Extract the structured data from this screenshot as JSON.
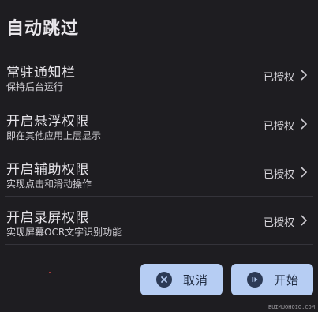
{
  "dialog": {
    "title": "自动跳过"
  },
  "items": [
    {
      "title": "常驻通知栏",
      "subtitle": "保持后台运行",
      "status": "已授权"
    },
    {
      "title": "开启悬浮权限",
      "subtitle": "即在其他应用上层显示",
      "status": "已授权"
    },
    {
      "title": "开启辅助权限",
      "subtitle": "实现点击和滑动操作",
      "status": "已授权"
    },
    {
      "title": "开启录屏权限",
      "subtitle": "实现屏幕OCR文字识别功能",
      "status": "已授权"
    }
  ],
  "buttons": {
    "cancel_label": "取消",
    "start_label": "开始"
  },
  "icons": {
    "chevron": "chevron-right-icon",
    "cancel": "close-circle-icon",
    "start": "play-circle-icon"
  },
  "colors": {
    "background": "#1e1d21",
    "button": "#b6cdf3",
    "text": "#e6e4e9"
  },
  "watermark": "BUIMUOHOIO.COM"
}
